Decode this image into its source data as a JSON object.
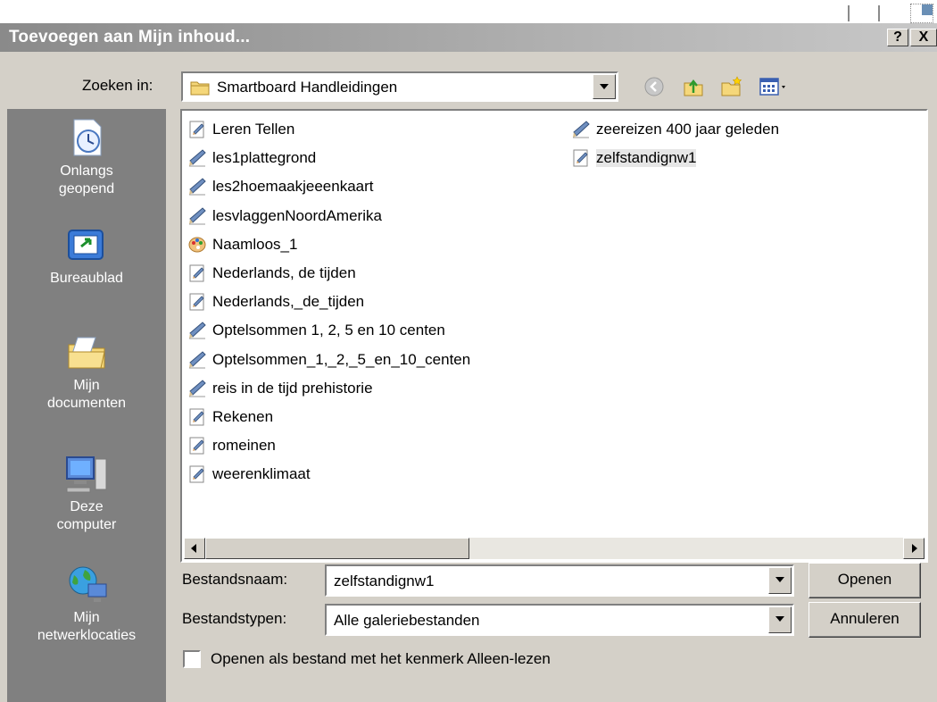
{
  "window": {
    "title": "Toevoegen aan Mijn inhoud...",
    "help_label": "?",
    "close_label": "X"
  },
  "look_in": {
    "label": "Zoeken in:",
    "value": "Smartboard Handleidingen"
  },
  "places": [
    {
      "label": "Onlangs geopend",
      "icon": "recent-icon"
    },
    {
      "label": "Bureaublad",
      "icon": "desktop-icon"
    },
    {
      "label": "Mijn documenten",
      "icon": "my-documents-icon"
    },
    {
      "label": "Deze computer",
      "icon": "my-computer-icon"
    },
    {
      "label": "Mijn netwerklocaties",
      "icon": "network-icon"
    }
  ],
  "files": {
    "column1": [
      {
        "name": "Leren Tellen",
        "icon": "notebook-doc-icon"
      },
      {
        "name": "les1plattegrond",
        "icon": "notebook-pen-icon"
      },
      {
        "name": "les2hoemaakjeeenkaart",
        "icon": "notebook-pen-icon"
      },
      {
        "name": "lesvlaggenNoordAmerika",
        "icon": "notebook-pen-icon"
      },
      {
        "name": "Naamloos_1",
        "icon": "palette-icon"
      },
      {
        "name": "Nederlands, de tijden",
        "icon": "notebook-doc-icon"
      },
      {
        "name": "Nederlands,_de_tijden",
        "icon": "notebook-doc-icon"
      },
      {
        "name": "Optelsommen 1, 2, 5 en 10 centen",
        "icon": "notebook-pen-icon"
      },
      {
        "name": "Optelsommen_1,_2,_5_en_10_centen",
        "icon": "notebook-pen-icon"
      },
      {
        "name": "reis in de tijd prehistorie",
        "icon": "notebook-pen-icon"
      },
      {
        "name": "Rekenen",
        "icon": "notebook-doc-icon"
      },
      {
        "name": "romeinen",
        "icon": "notebook-doc-icon"
      },
      {
        "name": "weerenklimaat",
        "icon": "notebook-doc-icon"
      }
    ],
    "column2": [
      {
        "name": "zeereizen 400 jaar geleden",
        "icon": "notebook-pen-icon"
      },
      {
        "name": "zelfstandignw1",
        "icon": "notebook-doc-icon",
        "selected": true
      }
    ]
  },
  "filename": {
    "label": "Bestandsnaam:",
    "value": "zelfstandignw1"
  },
  "filetype": {
    "label": "Bestandstypen:",
    "value": "Alle galeriebestanden"
  },
  "buttons": {
    "open": "Openen",
    "cancel": "Annuleren"
  },
  "readonly_checkbox": {
    "label": "Openen als bestand met het kenmerk Alleen-lezen",
    "checked": false
  }
}
